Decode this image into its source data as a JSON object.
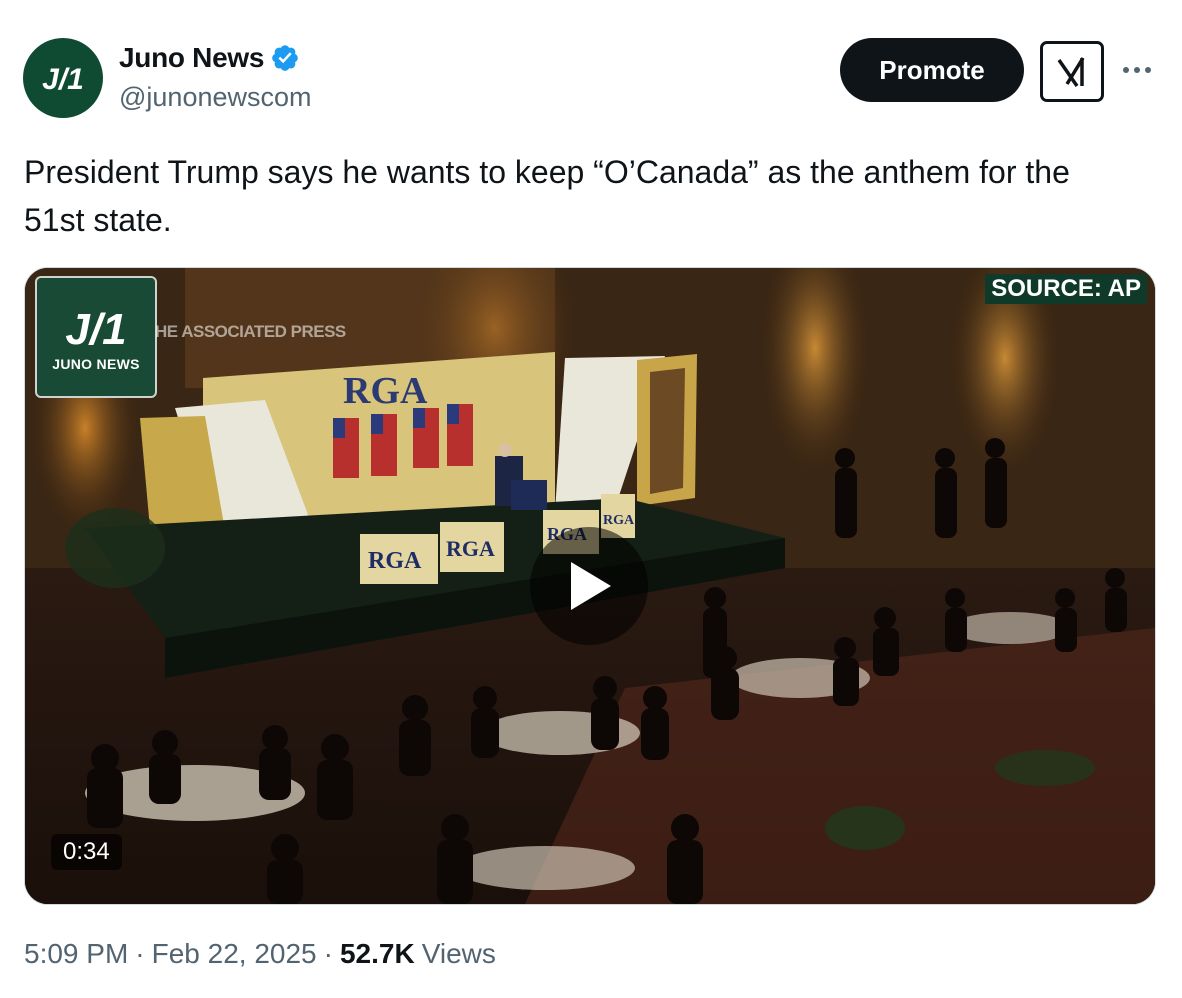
{
  "author": {
    "display_name": "Juno News",
    "handle": "@junonewscom",
    "avatar_text": "J/1",
    "verified": true,
    "accent_color": "#0f4a33"
  },
  "actions": {
    "promote_label": "Promote",
    "grok_icon": "grok-icon",
    "more_icon": "more-icon"
  },
  "tweet": {
    "text": "President Trump says he wants to keep “O’Canada” as the anthem for the 51st state."
  },
  "media": {
    "logo_text": "J/1",
    "logo_subtitle": "JUNO NEWS",
    "watermark": "HE ASSOCIATED PRESS",
    "source_label": "SOURCE: AP",
    "duration": "0:34",
    "stage_signs": [
      "RGA",
      "RGA",
      "RGA",
      "RGA",
      "RGA"
    ],
    "play_icon": "play-icon"
  },
  "meta": {
    "time": "5:09 PM",
    "date": "Feb 22, 2025",
    "views_count": "52.7K",
    "views_label": "Views",
    "separator": "·"
  }
}
